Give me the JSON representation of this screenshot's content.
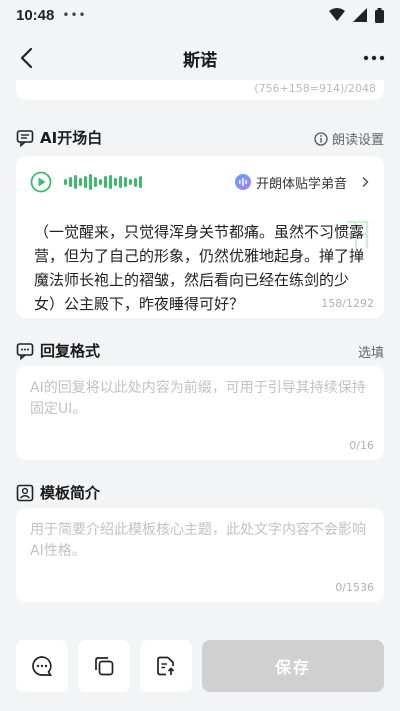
{
  "status_bar": {
    "time": "10:48",
    "dots": "•••"
  },
  "header": {
    "title": "斯诺"
  },
  "top_card": {
    "counter": "(756+158=914)/2048"
  },
  "ai_opening": {
    "title": "AI开场白",
    "reading_settings": "朗读设置",
    "voice_name": "开朗体贴学弟音",
    "text": "（一觉醒来，只觉得浑身关节都痛。虽然不习惯露营，但为了自己的形象，仍然优雅地起身。掸了掸魔法师长袍上的褶皱，然后看向已经在练剑的少女）公主殿下，昨夜睡得可好？",
    "counter": "158/1292"
  },
  "reply_format": {
    "title": "回复格式",
    "option": "选填",
    "placeholder": "AI的回复将以此处内容为前缀，可用于引导其持续保持固定UI。",
    "counter": "0/16"
  },
  "template_intro": {
    "title": "模板简介",
    "placeholder": "用于简要介绍此模板核心主题，此处文字内容不会影响AI性格。",
    "counter": "0/1536"
  },
  "bottom": {
    "save_label": "保存"
  },
  "colors": {
    "accent_green": "#3cba6e",
    "save_disabled": "#d0d0d0"
  },
  "icons": [
    "back-icon",
    "more-icon",
    "chat-icon",
    "copy-icon",
    "export-icon",
    "play-icon",
    "info-icon",
    "chevron-right-icon"
  ]
}
